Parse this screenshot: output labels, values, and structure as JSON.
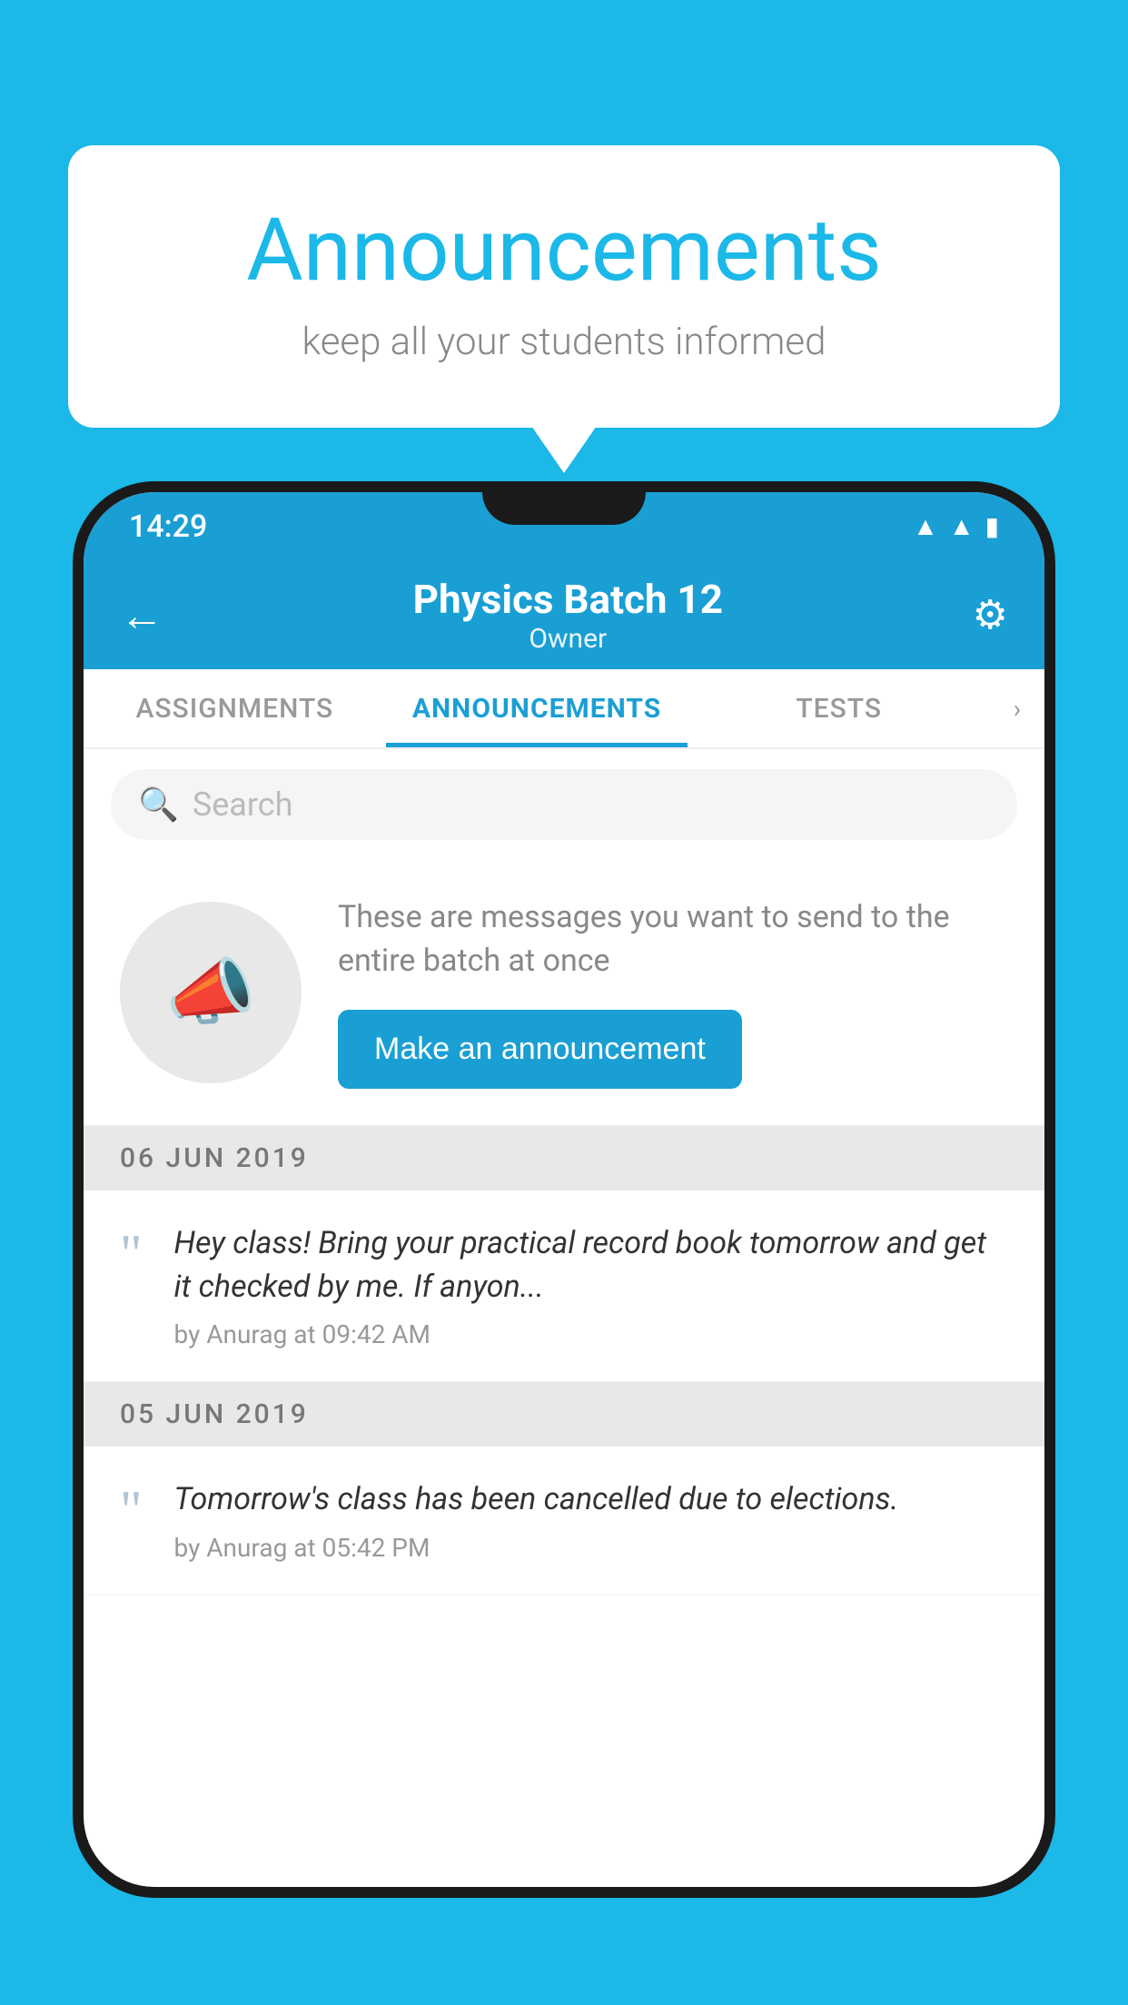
{
  "background_color": "#1BB8E8",
  "speech_bubble": {
    "title": "Announcements",
    "subtitle": "keep all your students informed"
  },
  "phone": {
    "status_bar": {
      "time": "14:29"
    },
    "header": {
      "title": "Physics Batch 12",
      "subtitle": "Owner",
      "back_label": "←",
      "settings_label": "⚙"
    },
    "tabs": [
      {
        "label": "ASSIGNMENTS",
        "active": false
      },
      {
        "label": "ANNOUNCEMENTS",
        "active": true
      },
      {
        "label": "TESTS",
        "active": false
      }
    ],
    "search": {
      "placeholder": "Search"
    },
    "announcement_prompt": {
      "description": "These are messages you want to send to the entire batch at once",
      "button_label": "Make an announcement"
    },
    "announcements": [
      {
        "date": "06  JUN  2019",
        "text": "Hey class! Bring your practical record book tomorrow and get it checked by me. If anyon...",
        "meta": "by Anurag at 09:42 AM"
      },
      {
        "date": "05  JUN  2019",
        "text": "Tomorrow's class has been cancelled due to elections.",
        "meta": "by Anurag at 05:42 PM"
      }
    ]
  }
}
